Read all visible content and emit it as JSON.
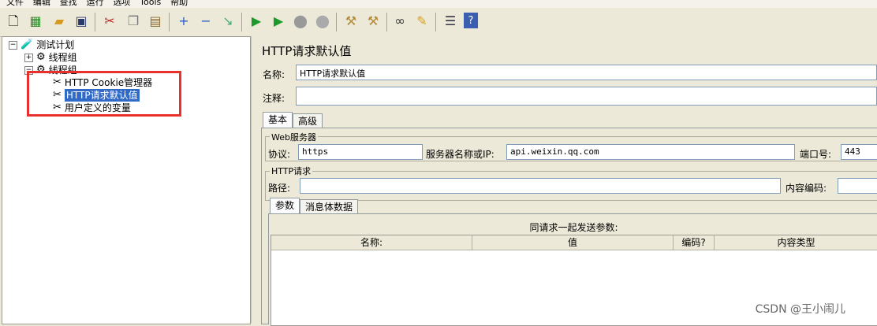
{
  "menu": [
    "文件",
    "编辑",
    "查找",
    "运行",
    "选项",
    "Tools",
    "帮助"
  ],
  "toolbar_icons": [
    "new-icon",
    "templates-icon",
    "open-icon",
    "save-icon",
    "cut-icon",
    "copy-icon",
    "paste-icon",
    "expand-icon",
    "collapse-icon",
    "toggle-icon",
    "start-icon",
    "start-no-pause-icon",
    "stop-icon",
    "shutdown-icon",
    "clear-icon",
    "clear-all-icon",
    "search-icon",
    "reset-search-icon",
    "function-helper-icon",
    "help-icon"
  ],
  "tree": {
    "root": "测试计划",
    "items": [
      {
        "label": "线程组"
      },
      {
        "label": "线程组"
      },
      {
        "label": "HTTP Cookie管理器"
      },
      {
        "label": "HTTP请求默认值"
      },
      {
        "label": "用户定义的变量"
      }
    ]
  },
  "panel": {
    "title": "HTTP请求默认值",
    "name_label": "名称:",
    "name_value": "HTTP请求默认值",
    "comment_label": "注释:",
    "comment_value": "",
    "tabs": [
      "基本",
      "高级"
    ],
    "web_server": {
      "group_label": "Web服务器",
      "protocol_label": "协议:",
      "protocol_value": "https",
      "server_label": "服务器名称或IP:",
      "server_value": "api.weixin.qq.com",
      "port_label": "端口号:",
      "port_value": "443"
    },
    "http_request": {
      "group_label": "HTTP请求",
      "path_label": "路径:",
      "path_value": "",
      "encoding_label": "内容编码:",
      "encoding_value": ""
    },
    "sub_tabs": [
      "参数",
      "消息体数据"
    ],
    "params_caption": "同请求一起发送参数:",
    "columns": [
      "名称:",
      "值",
      "编码?",
      "内容类型"
    ]
  },
  "watermark": "CSDN @王小闹儿",
  "colors": {
    "selection": "#3169c6",
    "highlight_box": "#e8302c"
  }
}
